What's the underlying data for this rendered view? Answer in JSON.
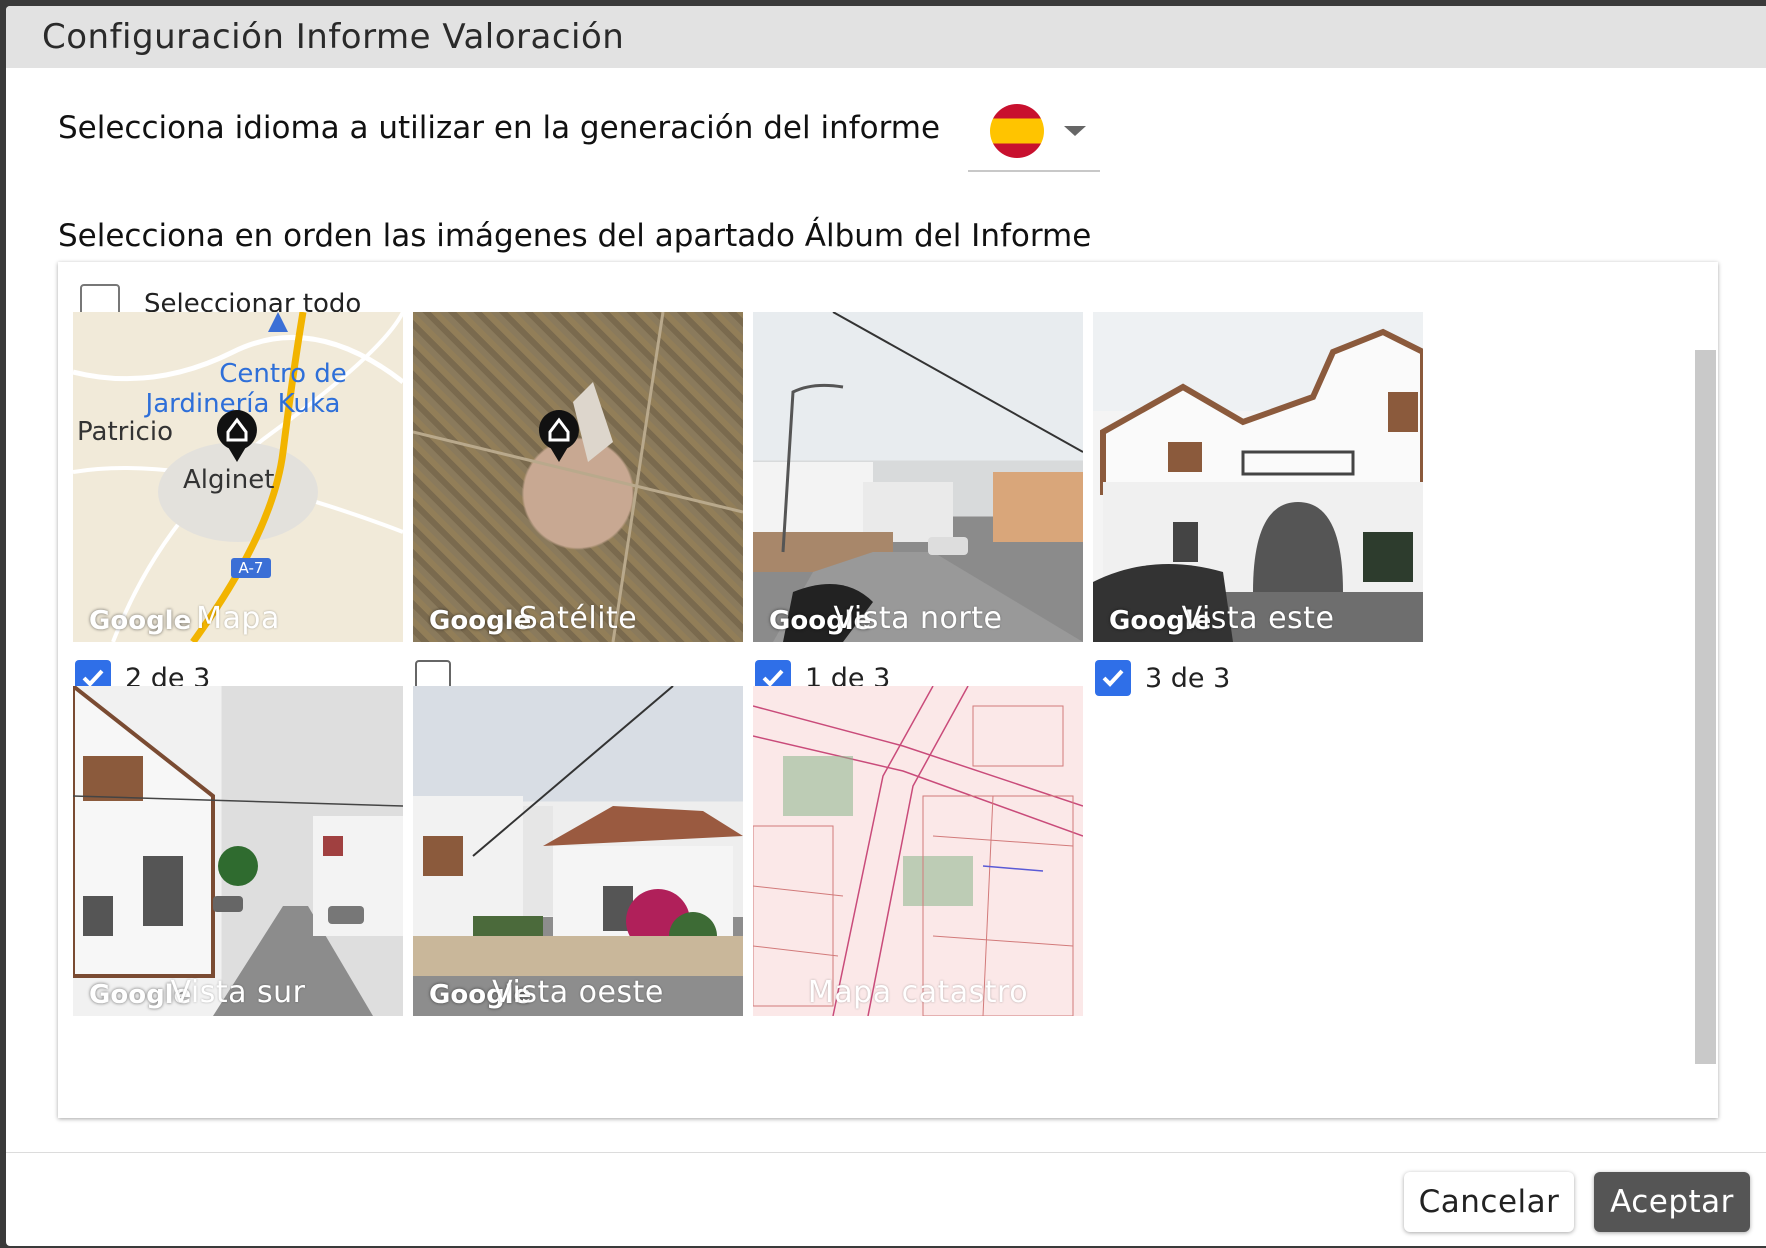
{
  "dialog": {
    "title": "Configuración Informe Valoración"
  },
  "language": {
    "label": "Selecciona idioma a utilizar en la generación del informe",
    "selected_flag": "spain-flag-icon"
  },
  "album": {
    "section_title": "Selecciona en orden las imágenes del apartado Álbum del Informe",
    "select_all_label": "Seleccionar todo",
    "select_all_checked": false,
    "images": [
      {
        "caption": "Mapa",
        "watermark": "Google",
        "checked": true,
        "order": "2 de 3"
      },
      {
        "caption": "Satélite",
        "watermark": "Google",
        "checked": false,
        "order": ""
      },
      {
        "caption": "Vista norte",
        "watermark": "Google",
        "checked": true,
        "order": "1 de 3"
      },
      {
        "caption": "Vista este",
        "watermark": "Google",
        "checked": true,
        "order": "3 de 3"
      },
      {
        "caption": "Vista sur",
        "watermark": "Google",
        "checked": null,
        "order": ""
      },
      {
        "caption": "Vista oeste",
        "watermark": "Google",
        "checked": null,
        "order": ""
      },
      {
        "caption": "Mapa catastro",
        "watermark": "",
        "checked": null,
        "order": ""
      }
    ],
    "map_labels": {
      "place1": "Centro de Jardinería Kuka",
      "place2": "Patricio",
      "place3": "Alginet",
      "road": "A-7"
    }
  },
  "buttons": {
    "cancel": "Cancelar",
    "accept": "Aceptar"
  },
  "colors": {
    "accent": "#2f6fe8",
    "accept_bg": "#555555",
    "title_bar": "#e2e2e2"
  }
}
